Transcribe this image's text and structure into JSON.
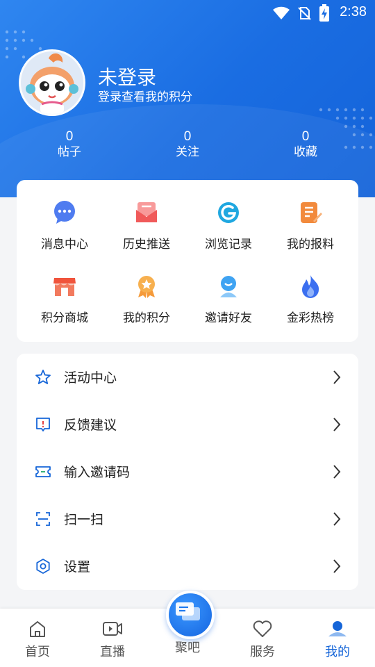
{
  "status_bar": {
    "time": "2:38"
  },
  "profile": {
    "name": "未登录",
    "subtitle": "登录查看我的积分",
    "stats": [
      {
        "value": "0",
        "label": "帖子"
      },
      {
        "value": "0",
        "label": "关注"
      },
      {
        "value": "0",
        "label": "收藏"
      }
    ]
  },
  "quick_grid": [
    {
      "label": "消息中心",
      "icon": "message-bubble-icon",
      "color": "#4f7cf0"
    },
    {
      "label": "历史推送",
      "icon": "mail-push-icon",
      "color": "#f05a5a"
    },
    {
      "label": "浏览记录",
      "icon": "browse-history-icon",
      "color": "#1fa7e0"
    },
    {
      "label": "我的报料",
      "icon": "report-note-icon",
      "color": "#f28a3c"
    },
    {
      "label": "积分商城",
      "icon": "store-icon",
      "color": "#f0543c"
    },
    {
      "label": "我的积分",
      "icon": "medal-icon",
      "color": "#f59a3a"
    },
    {
      "label": "邀请好友",
      "icon": "invite-friend-icon",
      "color": "#3fa3f2"
    },
    {
      "label": "金彩热榜",
      "icon": "flame-icon",
      "color": "#3b6ff0"
    }
  ],
  "menu": [
    {
      "label": "活动中心",
      "icon": "star-icon"
    },
    {
      "label": "反馈建议",
      "icon": "feedback-icon"
    },
    {
      "label": "输入邀请码",
      "icon": "ticket-icon"
    },
    {
      "label": "扫一扫",
      "icon": "scan-icon"
    },
    {
      "label": "设置",
      "icon": "settings-gear-icon"
    }
  ],
  "tabs": [
    {
      "label": "首页",
      "icon": "home-icon"
    },
    {
      "label": "直播",
      "icon": "live-video-icon"
    },
    {
      "label": "聚吧",
      "icon": "chat-bubbles-icon"
    },
    {
      "label": "服务",
      "icon": "heart-icon"
    },
    {
      "label": "我的",
      "icon": "user-profile-icon"
    }
  ],
  "colors": {
    "accent": "#1565d8",
    "header_start": "#2f86f0",
    "header_end": "#1463d9"
  }
}
